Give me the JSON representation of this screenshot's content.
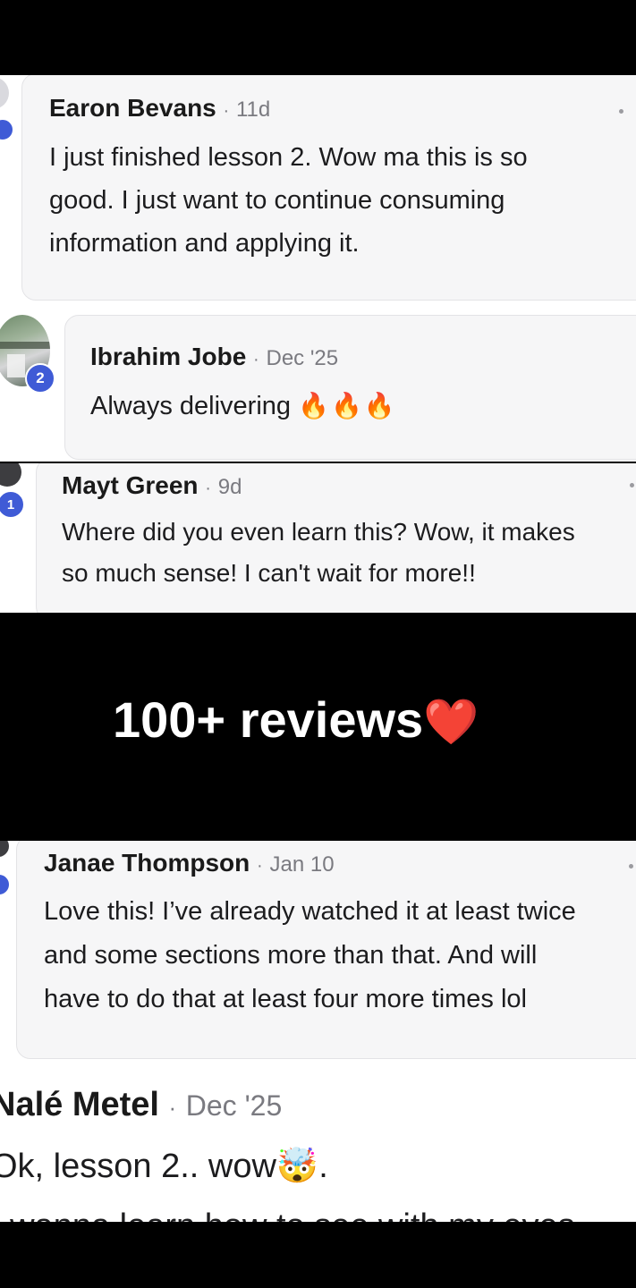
{
  "comments": [
    {
      "name": "Earon Bevans",
      "date": "11d",
      "lines": [
        "I just finished lesson 2. Wow ma this is so",
        "good. I just want to continue consuming",
        "information and applying it."
      ]
    },
    {
      "name": "Ibrahim Jobe",
      "date": "Dec '25",
      "text": "Always delivering",
      "emoji": "🔥🔥🔥",
      "badge": "2"
    },
    {
      "name": "Mayt Green",
      "date": "9d",
      "lines": [
        "Where did you even learn this? Wow, it makes",
        "so much sense! I can't wait for more!!"
      ],
      "badge": "1"
    },
    {
      "name": "Janae Thompson",
      "date": "Jan 10",
      "lines": [
        "Love this! I’ve already watched it at least twice",
        "and some sections more than that. And will",
        "have to do that at least four more times lol"
      ]
    },
    {
      "name": "Nalé Metel",
      "date": "Dec '25",
      "lines": [
        "Ok, lesson 2.. wow🤯.",
        "I wanna learn how to see with my eyes"
      ]
    }
  ],
  "separator": "·",
  "overlay": {
    "text": "100+ reviews",
    "emoji": "❤️"
  },
  "colors": {
    "badge": "#3f5bd6",
    "background": "#000000"
  }
}
